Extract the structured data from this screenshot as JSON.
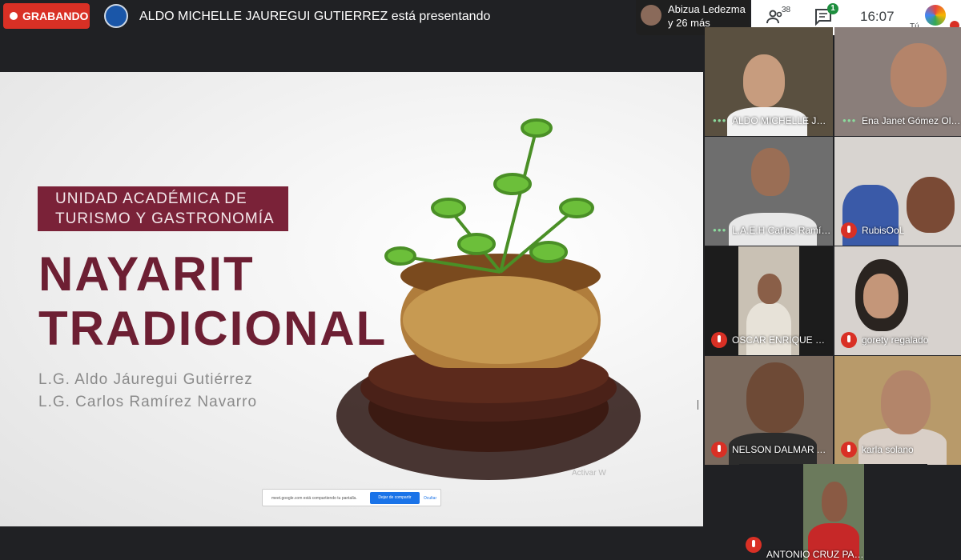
{
  "topbar": {
    "recording_label": "GRABANDO",
    "presenting_text": "ALDO MICHELLE JAUREGUI GUTIERREZ está presentando"
  },
  "viewers": {
    "name": "Abizua Ledezma",
    "more": "y 26 más"
  },
  "controls": {
    "participants_count": "38",
    "chat_badge": "1",
    "time": "16:07",
    "me_label": "Tú"
  },
  "slide": {
    "band_line1": "UNIDAD ACADÉMICA DE",
    "band_line2": "TURISMO Y GASTRONOMÍA",
    "title_line1": "NAYARIT",
    "title_line2": "TRADICIONAL",
    "author1": "L.G. Aldo Jáuregui Gutiérrez",
    "author2": "L.G. Carlos Ramírez Navarro",
    "watermark": "Activar W"
  },
  "share_bar": {
    "message": "meet.google.com está compartiendo tu pantalla.",
    "stop_label": "Dejar de compartir",
    "hide_label": "Ocultar"
  },
  "participants": [
    {
      "name": "ALDO MICHELLE JAU...",
      "muted": false,
      "speaking": true
    },
    {
      "name": "Ena Janet Gómez Olgu...",
      "muted": false,
      "speaking": true
    },
    {
      "name": "L.A.E.H Carlos Ramíre...",
      "muted": false,
      "speaking": true
    },
    {
      "name": "RubisOoL",
      "muted": true,
      "speaking": false
    },
    {
      "name": "OSCAR ENRIQUE SAL...",
      "muted": true,
      "speaking": false
    },
    {
      "name": "gorety regalado",
      "muted": true,
      "speaking": false
    },
    {
      "name": "NELSON DALMAR AN...",
      "muted": true,
      "speaking": false
    },
    {
      "name": "karla solano",
      "muted": true,
      "speaking": false
    },
    {
      "name": "ANTONIO CRUZ PAEZ",
      "muted": true,
      "speaking": false
    }
  ],
  "colors": {
    "recording": "#d93025",
    "slide_accent": "#7a2238",
    "meet_blue": "#1a73e8"
  },
  "icons": [
    "record-dot-icon",
    "people-icon",
    "chat-icon",
    "mic-off-icon",
    "avatar-icon"
  ]
}
